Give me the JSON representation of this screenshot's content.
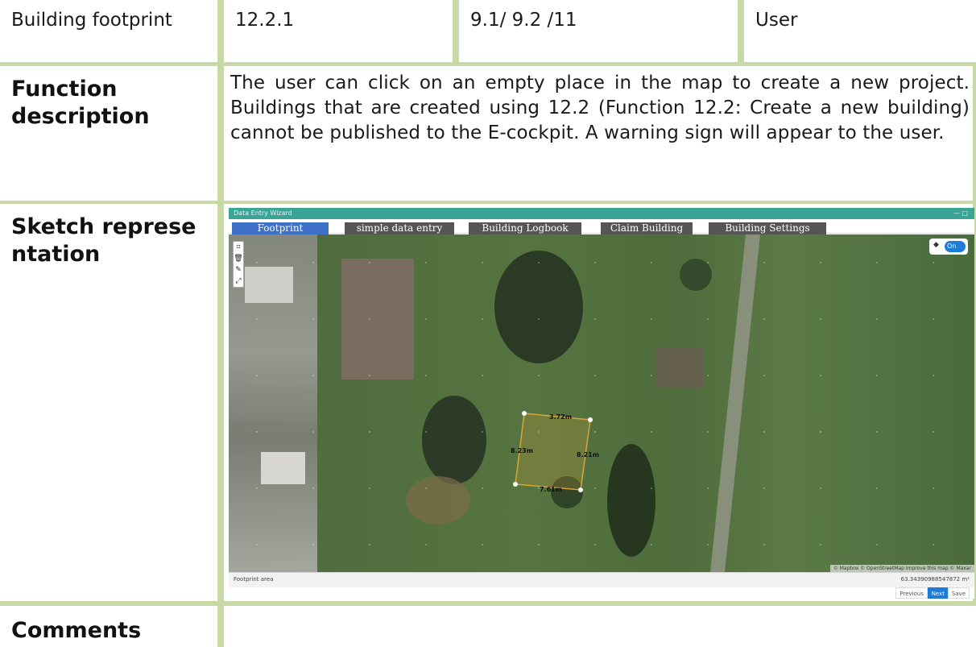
{
  "table": {
    "row1": {
      "name": "Building footprint",
      "id": "12.2.1",
      "ref": "9.1/ 9.2 /11",
      "actor": "User"
    },
    "function_description": {
      "label": "Function description",
      "text": "The user can click on an empty place in the map to create a new project. Buildings that are created using 12.2 (Function 12.2: Create a new building) cannot be published to the E-cockpit. A warning sign will appear to the user."
    },
    "sketch": {
      "label": "Sketch representation"
    },
    "comments": {
      "label": "Comments",
      "text": ""
    }
  },
  "screenshot": {
    "window_title": "Data Entry Wizard",
    "window_controls": "—  □",
    "tabs": [
      {
        "label": "Footprint",
        "active": true
      },
      {
        "label": "simple data entry",
        "active": false
      },
      {
        "label": "Building Logbook",
        "active": false
      },
      {
        "label": "Claim Building",
        "active": false
      },
      {
        "label": "Building Settings",
        "active": false
      }
    ],
    "toolbar_icons": [
      "polygon-icon",
      "trash-icon",
      "edit-icon",
      "split-icon"
    ],
    "toggle_label": "On",
    "polygon_labels": {
      "top": "3.72m",
      "left": "8.23m",
      "right": "8.21m",
      "bottom": "7.61m"
    },
    "map_attribution": "© Mapbox © OpenStreetMap  Improve this map © Maxar",
    "footprint_area_label": "Footprint area",
    "footprint_area_value": "63.34390988547872 m²",
    "buttons": {
      "previous": "Previous",
      "next": "Next",
      "save": "Save"
    },
    "colors": {
      "title_bar": "#3aa596",
      "active_tab": "#3c71c7",
      "inactive_tab": "#555555",
      "polygon": "#d9a63a",
      "primary_button": "#1e7bd6"
    }
  }
}
